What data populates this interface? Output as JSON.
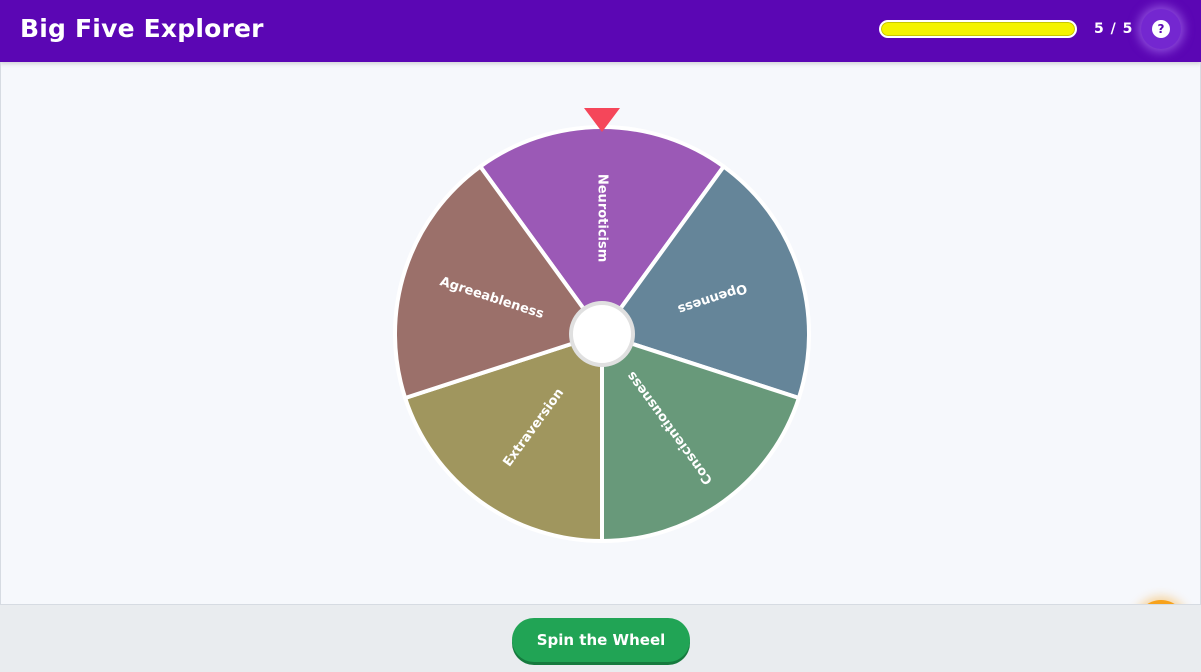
{
  "header": {
    "title": "Big Five Explorer",
    "progress_fraction": 1.0,
    "progress_text": "5 / 5",
    "help_icon": "question-mark-icon"
  },
  "wheel": {
    "segments": [
      {
        "label": "Neuroticism",
        "color": "#9b59b6"
      },
      {
        "label": "Openness",
        "color": "#658599"
      },
      {
        "label": "Conscientiousness",
        "color": "#68997a"
      },
      {
        "label": "Extraversion",
        "color": "#a0965e"
      },
      {
        "label": "Agreeableness",
        "color": "#9b706a"
      }
    ],
    "pointer_color": "#f5465a",
    "hub_icon": "wheel-hub"
  },
  "hint": {
    "icon": "lightbulb-icon",
    "color": "#f7a21c"
  },
  "footer": {
    "spin_label": "Spin the Wheel"
  }
}
